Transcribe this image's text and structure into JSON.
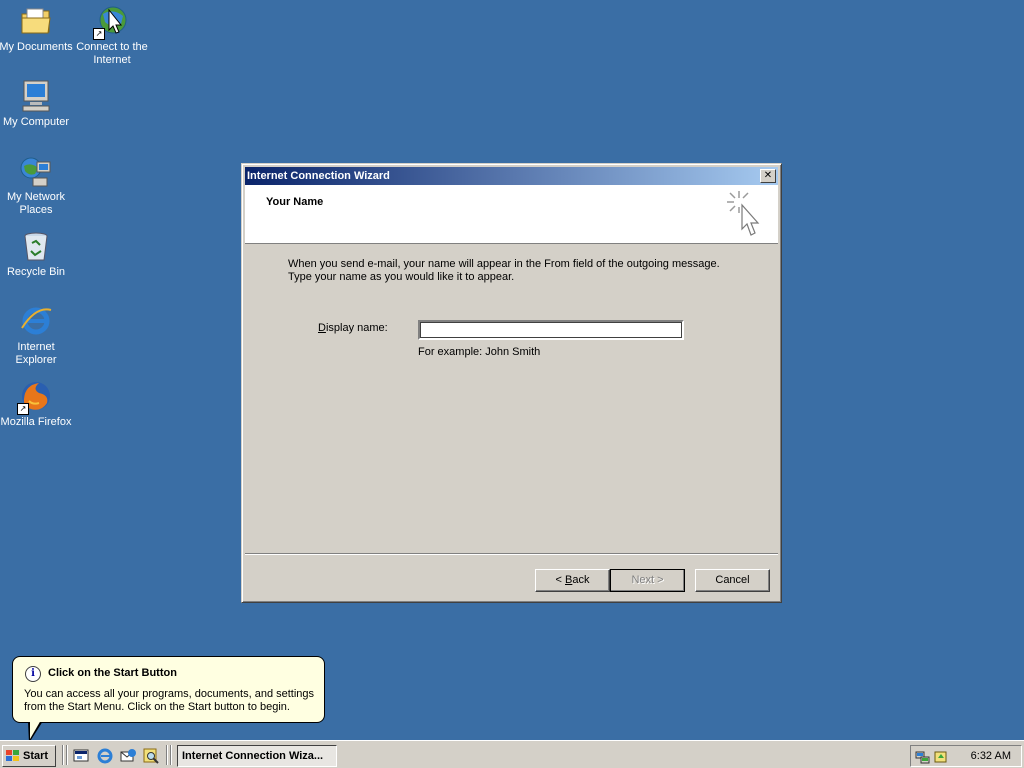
{
  "desktop": {
    "background_color": "#3a6ea5",
    "icons": [
      {
        "label": "My Documents",
        "icon": "folder-documents-icon"
      },
      {
        "label": "Connect to the Internet",
        "icon": "connect-internet-icon"
      },
      {
        "label": "My Computer",
        "icon": "computer-icon"
      },
      {
        "label": "My Network Places",
        "icon": "network-places-icon"
      },
      {
        "label": "Recycle Bin",
        "icon": "recycle-bin-icon"
      },
      {
        "label": "Internet Explorer",
        "icon": "internet-explorer-icon"
      },
      {
        "label": "Mozilla Firefox",
        "icon": "firefox-icon"
      }
    ]
  },
  "dialog": {
    "title": "Internet Connection Wizard",
    "close_label": "✕",
    "header_title": "Your Name",
    "body_line1": "When you send e-mail, your name will appear in the From field of the outgoing message.",
    "body_line2": "Type your name as you would like it to appear.",
    "field_label_pre": "D",
    "field_label_rest": "isplay name:",
    "field_value": "",
    "example_text": "For example: John Smith",
    "buttons": {
      "back_pre": "< ",
      "back_accel": "B",
      "back_rest": "ack",
      "next": "Next >",
      "cancel": "Cancel"
    },
    "next_disabled": true
  },
  "balloon": {
    "title": "Click on the Start Button",
    "body": "You can access all your programs, documents, and settings from the Start Menu. Click on the Start button to begin."
  },
  "taskbar": {
    "start_label": "Start",
    "quick_launch": [
      "show-desktop-icon",
      "internet-explorer-icon",
      "outlook-express-icon",
      "search-icon"
    ],
    "active_task": "Internet Connection Wiza...",
    "tray_icons": [
      "network-tray-icon",
      "volume-tray-icon"
    ],
    "clock": "6:32 AM"
  }
}
